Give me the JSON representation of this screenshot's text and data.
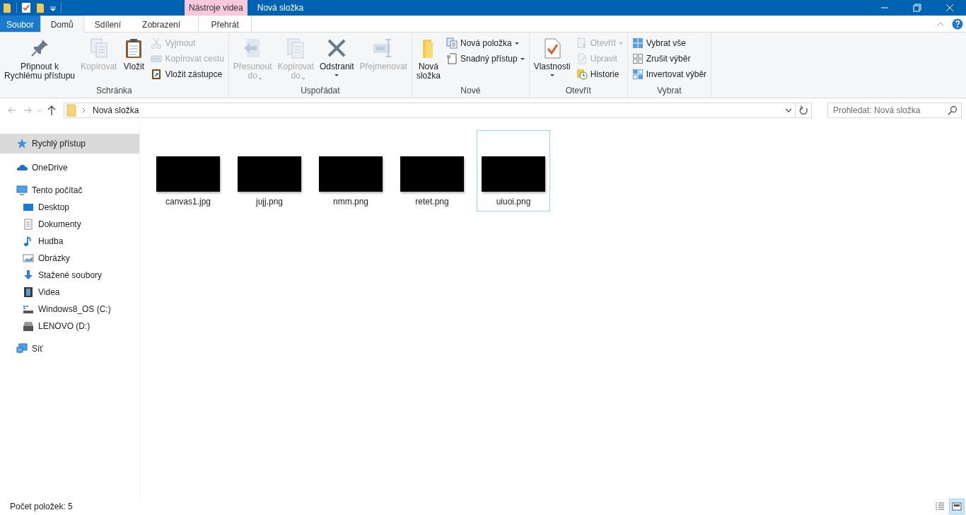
{
  "window": {
    "title": "Nová složka",
    "context_tab": "Nástroje videa"
  },
  "ribbon_tabs": [
    {
      "label": "Soubor",
      "kind": "file",
      "selected": false
    },
    {
      "label": "Domů",
      "kind": "tab",
      "selected": true
    },
    {
      "label": "Sdílení",
      "kind": "tab",
      "selected": false
    },
    {
      "label": "Zobrazení",
      "kind": "tab",
      "selected": false
    },
    {
      "label": "Přehrát",
      "kind": "context",
      "selected": false
    }
  ],
  "ribbon_groups": [
    {
      "label": "Schránka",
      "columns": [
        {
          "kind": "large",
          "label": "Připnout k\nRychlému přístupu",
          "disabled": false,
          "has_menu": false
        },
        {
          "kind": "large",
          "label": "Kopírovat",
          "disabled": true,
          "has_menu": false
        },
        {
          "kind": "large",
          "label": "Vložit",
          "disabled": false,
          "has_menu": false
        },
        {
          "kind": "stack",
          "items": [
            {
              "label": "Vyjmout",
              "disabled": true,
              "has_menu": false
            },
            {
              "label": "Kopírovat cestu",
              "disabled": true,
              "has_menu": false
            },
            {
              "label": "Vložit zástupce",
              "disabled": false,
              "has_menu": false
            }
          ]
        }
      ]
    },
    {
      "label": "Uspořádat",
      "columns": [
        {
          "kind": "large",
          "label": "Přesunout\ndo",
          "disabled": true,
          "has_menu": true
        },
        {
          "kind": "large",
          "label": "Kopírovat\ndo",
          "disabled": true,
          "has_menu": true
        },
        {
          "kind": "large",
          "label": "Odstranit",
          "disabled": false,
          "has_menu": true
        },
        {
          "kind": "large",
          "label": "Přejmenovat",
          "disabled": true,
          "has_menu": false
        }
      ]
    },
    {
      "label": "Nové",
      "columns": [
        {
          "kind": "large",
          "label": "Nová\nsložka",
          "disabled": false,
          "has_menu": false
        },
        {
          "kind": "stack",
          "items": [
            {
              "label": "Nová položka",
              "disabled": false,
              "has_menu": true
            },
            {
              "label": "Snadný přístup",
              "disabled": false,
              "has_menu": true
            }
          ]
        }
      ]
    },
    {
      "label": "Otevřít",
      "columns": [
        {
          "kind": "large",
          "label": "Vlastnosti",
          "disabled": false,
          "has_menu": true
        },
        {
          "kind": "stack",
          "items": [
            {
              "label": "Otevřít",
              "disabled": true,
              "has_menu": true
            },
            {
              "label": "Upravit",
              "disabled": true,
              "has_menu": false
            },
            {
              "label": "Historie",
              "disabled": false,
              "has_menu": false
            }
          ]
        }
      ]
    },
    {
      "label": "Vybrat",
      "columns": [
        {
          "kind": "stack",
          "items": [
            {
              "label": "Vybrat vše",
              "disabled": false,
              "has_menu": false
            },
            {
              "label": "Zrušit výběr",
              "disabled": false,
              "has_menu": false
            },
            {
              "label": "Invertovat výběr",
              "disabled": false,
              "has_menu": false
            }
          ]
        }
      ]
    }
  ],
  "navigation": {
    "back_disabled": true,
    "forward_disabled": true,
    "path": "Nová složka",
    "search": {
      "placeholder": "Prohledat: Nová složka"
    }
  },
  "sidebar": {
    "items": [
      {
        "label": "Rychlý přístup",
        "selected": true
      },
      {
        "label": "OneDrive",
        "selected": false
      },
      {
        "label": "Tento počítač",
        "selected": false,
        "children": [
          {
            "label": "Desktop",
            "selected": false
          },
          {
            "label": "Dokumenty",
            "selected": false
          },
          {
            "label": "Hudba",
            "selected": false
          },
          {
            "label": "Obrázky",
            "selected": false
          },
          {
            "label": "Stažené soubory",
            "selected": false
          },
          {
            "label": "Videa",
            "selected": false
          },
          {
            "label": "Windows8_OS (C:)",
            "selected": false
          },
          {
            "label": "LENOVO (D:)",
            "selected": false
          }
        ]
      },
      {
        "label": "Síť",
        "selected": false
      }
    ]
  },
  "files": [
    {
      "name": "canvas1.jpg",
      "focused": false
    },
    {
      "name": "jujj.png",
      "focused": false
    },
    {
      "name": "nmm.png",
      "focused": false
    },
    {
      "name": "retet.png",
      "focused": false
    },
    {
      "name": "uiuoi.png",
      "focused": true
    }
  ],
  "status_bar": {
    "text": "Počet položek: 5",
    "views": [
      {
        "selected": false
      },
      {
        "selected": true
      }
    ]
  }
}
